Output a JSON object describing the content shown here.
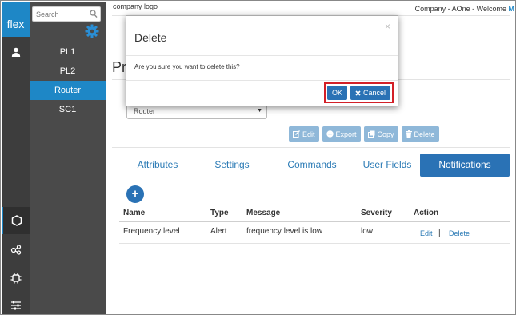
{
  "brand": "flex",
  "sidebar": {
    "search_placeholder": "Search",
    "items": [
      {
        "label": "PL1",
        "selected": false
      },
      {
        "label": "PL2",
        "selected": false
      },
      {
        "label": "Router",
        "selected": true
      },
      {
        "label": "SC1",
        "selected": false
      }
    ]
  },
  "rail": {
    "icons": [
      "user-icon",
      "hexagon-icon",
      "nodes-icon",
      "chip-icon",
      "sliders-icon"
    ],
    "active": "hexagon-icon"
  },
  "header": {
    "logo": "company logo",
    "welcome": "Company - AOne - Welcome",
    "welcome_user_initial": "M"
  },
  "page": {
    "title_fragment": "Pr",
    "type_select_value": "Router",
    "toolbar": {
      "edit": "Edit",
      "export": "Export",
      "copy": "Copy",
      "delete": "Delete"
    },
    "tabs": [
      {
        "label": "Attributes",
        "active": false
      },
      {
        "label": "Settings",
        "active": false
      },
      {
        "label": "Commands",
        "active": false
      },
      {
        "label": "User Fields",
        "active": false
      },
      {
        "label": "Notifications",
        "active": true
      }
    ],
    "add_label": "+",
    "table": {
      "headers": [
        "Name",
        "Type",
        "Message",
        "Severity",
        "Action"
      ],
      "rows": [
        {
          "name": "Frequency level",
          "type": "Alert",
          "message": "frequency level is low",
          "severity": "low",
          "actions": [
            "Edit",
            "Delete"
          ],
          "separator": "|"
        }
      ]
    }
  },
  "dialog": {
    "title": "Delete",
    "close": "×",
    "message": "Are you sure you want to delete this?",
    "ok": "OK",
    "cancel": "Cancel"
  },
  "colors": {
    "accent": "#1e87c6",
    "button": "#2a72b5",
    "disabled_button": "#8fb8d9",
    "highlight_border": "#d32027",
    "rail_bg": "#3d3d3d",
    "tree_bg": "#4a4a4a"
  }
}
